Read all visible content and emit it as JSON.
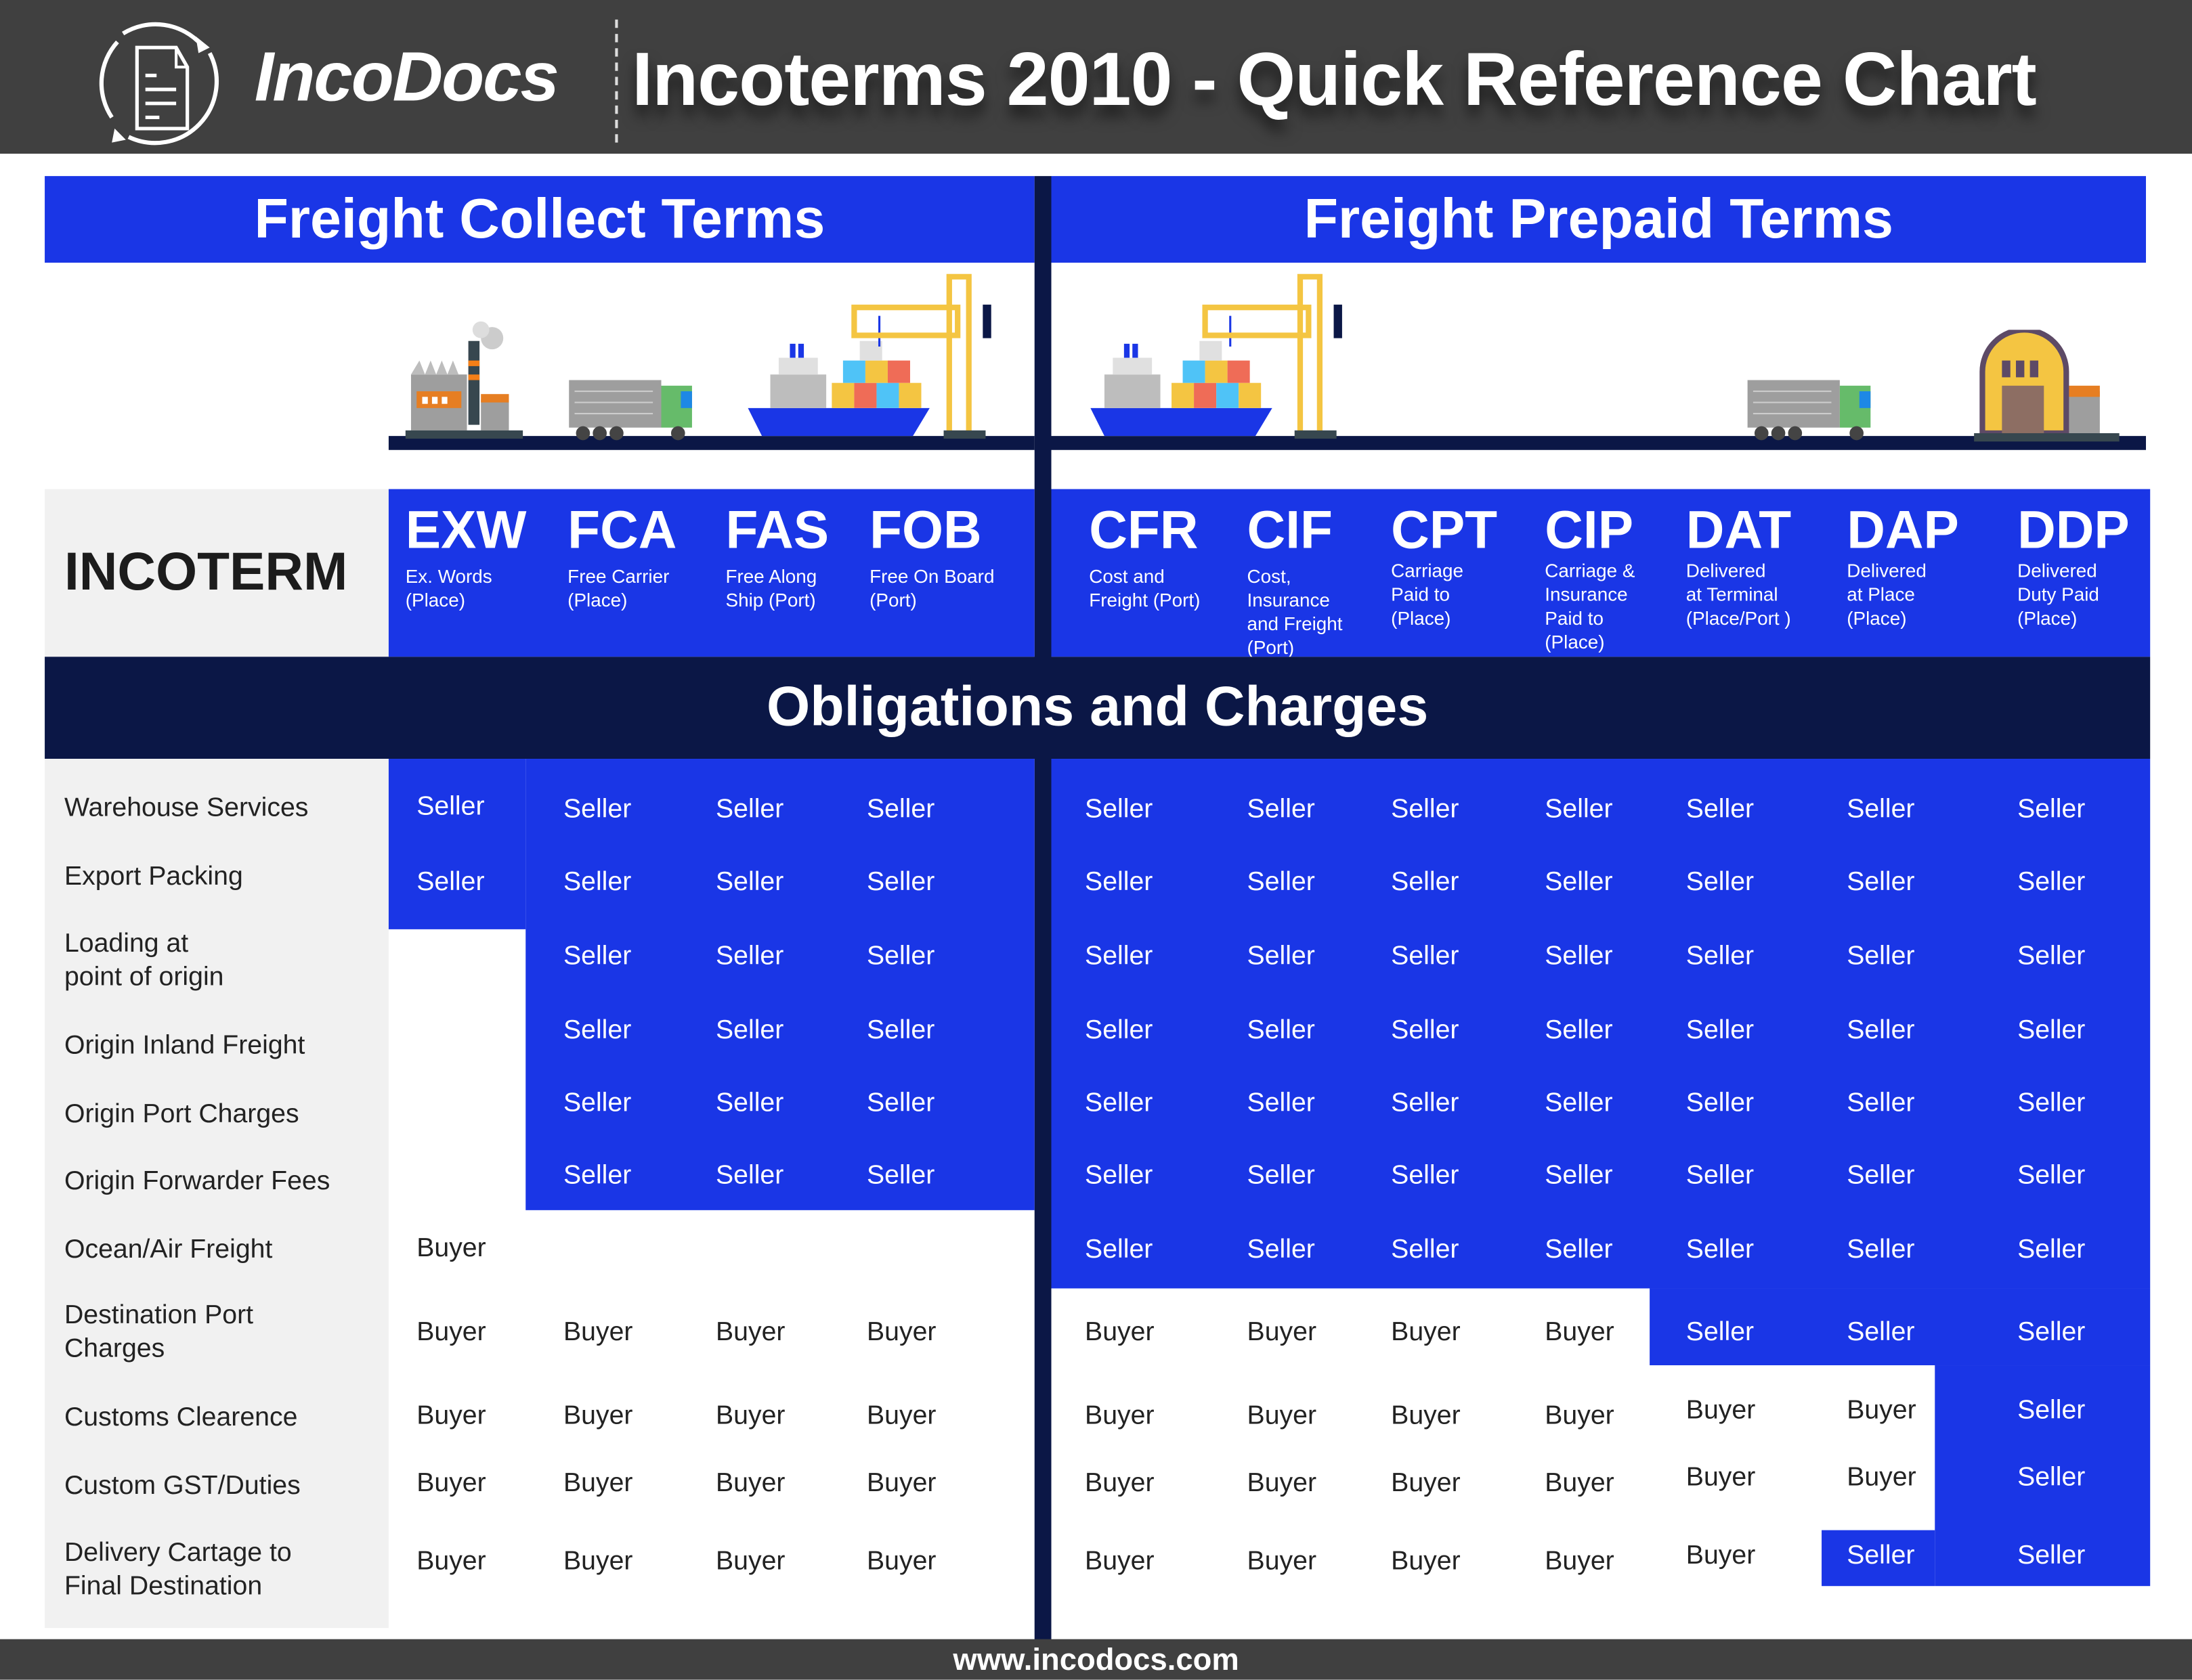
{
  "header": {
    "brand": "IncoDocs",
    "title": "Incoterms 2010 - Quick Reference Chart"
  },
  "sections": {
    "collect": "Freight Collect Terms",
    "prepaid": "Freight Prepaid Terms"
  },
  "incoterm_label": "INCOTERM",
  "obligations_title": "Obligations and Charges",
  "terms": [
    {
      "code": "EXW",
      "desc": [
        "Ex. Words",
        "(Place)"
      ]
    },
    {
      "code": "FCA",
      "desc": [
        "Free Carrier",
        "(Place)"
      ]
    },
    {
      "code": "FAS",
      "desc": [
        "Free Along",
        "Ship (Port)"
      ]
    },
    {
      "code": "FOB",
      "desc": [
        "Free On Board",
        "(Port)"
      ]
    },
    {
      "code": "CFR",
      "desc": [
        "Cost and",
        "Freight (Port)"
      ]
    },
    {
      "code": "CIF",
      "desc": [
        "Cost,",
        "Insurance",
        "and Freight",
        "(Port)"
      ]
    },
    {
      "code": "CPT",
      "desc": [
        "Carriage",
        "Paid to",
        "(Place)"
      ]
    },
    {
      "code": "CIP",
      "desc": [
        "Carriage &",
        "Insurance",
        "Paid to",
        "(Place)"
      ]
    },
    {
      "code": "DAT",
      "desc": [
        "Delivered",
        "at Terminal",
        "(Place/Port )"
      ]
    },
    {
      "code": "DAP",
      "desc": [
        "Delivered",
        "at Place",
        "(Place)"
      ]
    },
    {
      "code": "DDP",
      "desc": [
        "Delivered",
        "Duty Paid",
        "(Place)"
      ]
    }
  ],
  "rows": [
    {
      "label": [
        "Warehouse Services"
      ],
      "values": [
        "Seller",
        "Seller",
        "Seller",
        "Seller",
        "Seller",
        "Seller",
        "Seller",
        "Seller",
        "Seller",
        "Seller",
        "Seller"
      ]
    },
    {
      "label": [
        "Export Packing"
      ],
      "values": [
        "Seller",
        "Seller",
        "Seller",
        "Seller",
        "Seller",
        "Seller",
        "Seller",
        "Seller",
        "Seller",
        "Seller",
        "Seller"
      ]
    },
    {
      "label": [
        "Loading at",
        "point of origin"
      ],
      "values": [
        "",
        "Seller",
        "Seller",
        "Seller",
        "Seller",
        "Seller",
        "Seller",
        "Seller",
        "Seller",
        "Seller",
        "Seller"
      ]
    },
    {
      "label": [
        "Origin Inland Freight"
      ],
      "values": [
        "",
        "Seller",
        "Seller",
        "Seller",
        "Seller",
        "Seller",
        "Seller",
        "Seller",
        "Seller",
        "Seller",
        "Seller"
      ]
    },
    {
      "label": [
        "Origin Port Charges"
      ],
      "values": [
        "",
        "Seller",
        "Seller",
        "Seller",
        "Seller",
        "Seller",
        "Seller",
        "Seller",
        "Seller",
        "Seller",
        "Seller"
      ]
    },
    {
      "label": [
        "Origin Forwarder Fees"
      ],
      "values": [
        "",
        "Seller",
        "Seller",
        "Seller",
        "Seller",
        "Seller",
        "Seller",
        "Seller",
        "Seller",
        "Seller",
        "Seller"
      ]
    },
    {
      "label": [
        "Ocean/Air Freight"
      ],
      "values": [
        "Buyer",
        "",
        "",
        "",
        "Seller",
        "Seller",
        "Seller",
        "Seller",
        "Seller",
        "Seller",
        "Seller"
      ]
    },
    {
      "label": [
        "Destination Port",
        "Charges"
      ],
      "values": [
        "Buyer",
        "Buyer",
        "Buyer",
        "Buyer",
        "Buyer",
        "Buyer",
        "Buyer",
        "Buyer",
        "Seller",
        "Seller",
        "Seller"
      ]
    },
    {
      "label": [
        "Customs Clearence"
      ],
      "values": [
        "Buyer",
        "Buyer",
        "Buyer",
        "Buyer",
        "Buyer",
        "Buyer",
        "Buyer",
        "Buyer",
        "Buyer",
        "Buyer",
        "Seller"
      ]
    },
    {
      "label": [
        "Custom GST/Duties"
      ],
      "values": [
        "Buyer",
        "Buyer",
        "Buyer",
        "Buyer",
        "Buyer",
        "Buyer",
        "Buyer",
        "Buyer",
        "Buyer",
        "Buyer",
        "Seller"
      ]
    },
    {
      "label": [
        "Delivery Cartage to",
        "Final Destination"
      ],
      "values": [
        "Buyer",
        "Buyer",
        "Buyer",
        "Buyer",
        "Buyer",
        "Buyer",
        "Buyer",
        "Buyer",
        "Buyer",
        "Seller",
        "Seller"
      ]
    }
  ],
  "footer": "www.incodocs.com",
  "colors": {
    "header_bg": "#404040",
    "seller_blue": "#1a36e6",
    "navy": "#0b1746",
    "label_bg": "#f1f1f1"
  }
}
